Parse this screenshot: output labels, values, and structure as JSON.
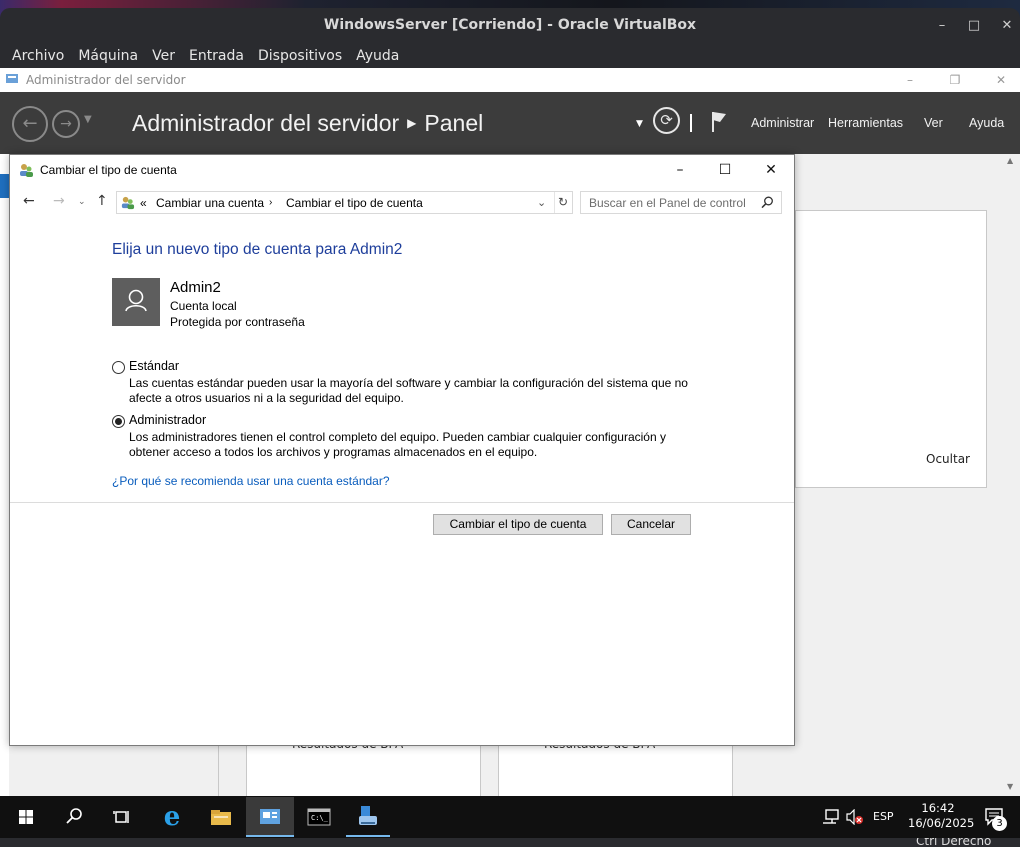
{
  "vbox": {
    "title": "WindowsServer [Corriendo] - Oracle VirtualBox",
    "menu": [
      "Archivo",
      "Máquina",
      "Ver",
      "Entrada",
      "Dispositivos",
      "Ayuda"
    ],
    "host_key_label": "Ctrl Derecho"
  },
  "server_manager": {
    "window_title": "Administrador del servidor",
    "breadcrumb_root": "Administrador del servidor",
    "breadcrumb_current": "Panel",
    "menu": {
      "manage": "Administrar",
      "tools": "Herramientas",
      "view": "Ver",
      "help": "Ayuda"
    },
    "hide_label": "Ocultar",
    "bpa_label_1": "Resultados de BPA",
    "bpa_label_2": "Resultados de BPA"
  },
  "dialog": {
    "title": "Cambiar el tipo de cuenta",
    "address": {
      "prefix": "«",
      "crumb1": "Cambiar una cuenta",
      "crumb2": "Cambiar el tipo de cuenta"
    },
    "search_placeholder": "Buscar en el Panel de control",
    "heading": "Elija un nuevo tipo de cuenta para Admin2",
    "account": {
      "name": "Admin2",
      "type": "Cuenta local",
      "status": "Protegida por contraseña"
    },
    "options": [
      {
        "label": "Estándar",
        "checked": false,
        "desc_line1": "Las cuentas estándar pueden usar la mayoría del software y cambiar la configuración del sistema que no",
        "desc_line2": "afecte a otros usuarios ni a la seguridad del equipo."
      },
      {
        "label": "Administrador",
        "checked": true,
        "desc_line1": "Los administradores tienen el control completo del equipo. Pueden cambiar cualquier configuración y",
        "desc_line2": "obtener acceso a todos los archivos y programas almacenados en el equipo."
      }
    ],
    "link_why": "¿Por qué se recomienda usar una cuenta estándar?",
    "btn_change": "Cambiar el tipo de cuenta",
    "btn_cancel": "Cancelar"
  },
  "taskbar": {
    "language": "ESP",
    "time": "16:42",
    "date": "16/06/2025",
    "notification_count": "3"
  },
  "icons": [
    "windows-start-icon",
    "search-icon",
    "task-view-icon",
    "ie-icon",
    "file-explorer-icon",
    "server-manager-icon",
    "cmd-icon",
    "network-icon",
    "flag-icon",
    "refresh-icon",
    "user-avatar-icon"
  ]
}
